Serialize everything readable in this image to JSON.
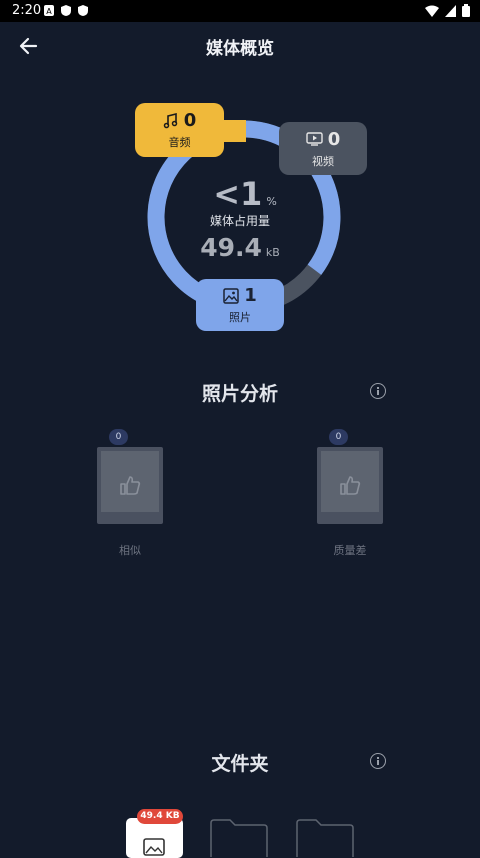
{
  "status_bar": {
    "time": "2:20"
  },
  "header": {
    "title": "媒体概览"
  },
  "overview": {
    "percent_value": "<1",
    "percent_unit": "%",
    "usage_label": "媒体占用量",
    "size_value": "49.4",
    "size_unit": "kB",
    "chips": [
      {
        "label": "音频",
        "count": "0",
        "color": "#f0b93a",
        "icon": "music-note-icon"
      },
      {
        "label": "视频",
        "count": "0",
        "color": "#4b5360",
        "icon": "video-play-icon"
      },
      {
        "label": "照片",
        "count": "1",
        "color": "#7fa5ea",
        "icon": "image-icon"
      }
    ]
  },
  "photo_analysis": {
    "title": "照片分析",
    "items": [
      {
        "label": "相似",
        "count": "0",
        "icon": "thumbs-up-icon"
      },
      {
        "label": "质量差",
        "count": "0",
        "icon": "thumbs-up-icon"
      }
    ]
  },
  "folders": {
    "title": "文件夹",
    "first_size": "49.4 KB"
  }
}
